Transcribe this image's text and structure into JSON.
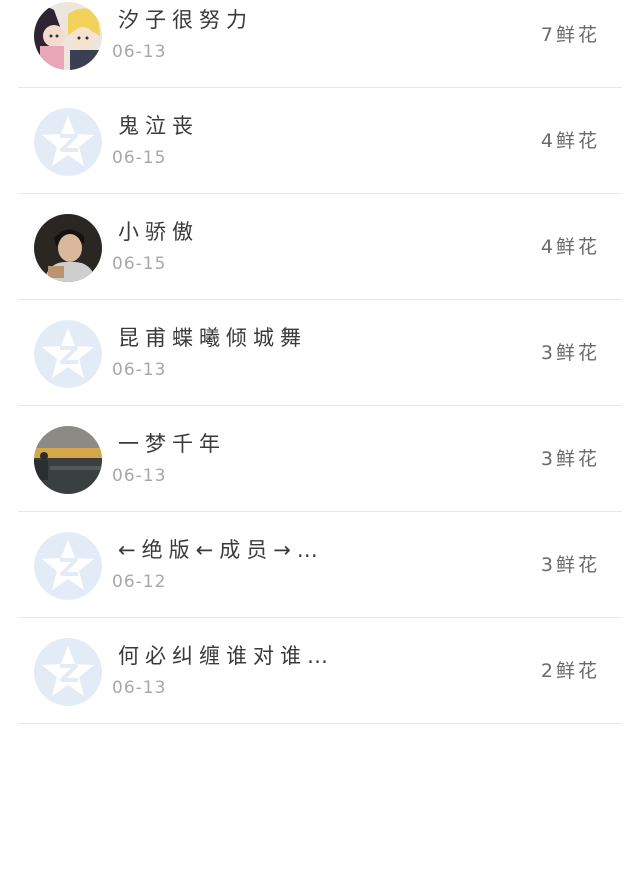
{
  "items": [
    {
      "name": "汐子很努力",
      "date": "06-13",
      "flowers": "7鲜花",
      "avatar": "anime-avatar"
    },
    {
      "name": "鬼泣丧",
      "date": "06-15",
      "flowers": "4鲜花",
      "avatar": "default-qzone-avatar"
    },
    {
      "name": "小骄傲",
      "date": "06-15",
      "flowers": "4鲜花",
      "avatar": "person-photo-avatar"
    },
    {
      "name": "昆甫蝶曦倾城舞",
      "date": "06-13",
      "flowers": "3鲜花",
      "avatar": "default-qzone-avatar"
    },
    {
      "name": "一梦千年",
      "date": "06-13",
      "flowers": "3鲜花",
      "avatar": "sunset-landscape-avatar"
    },
    {
      "name": "←绝版←成员→…",
      "date": "06-12",
      "flowers": "3鲜花",
      "avatar": "default-qzone-avatar"
    },
    {
      "name": "何必纠缠谁对谁…",
      "date": "06-13",
      "flowers": "2鲜花",
      "avatar": "default-qzone-avatar"
    }
  ]
}
